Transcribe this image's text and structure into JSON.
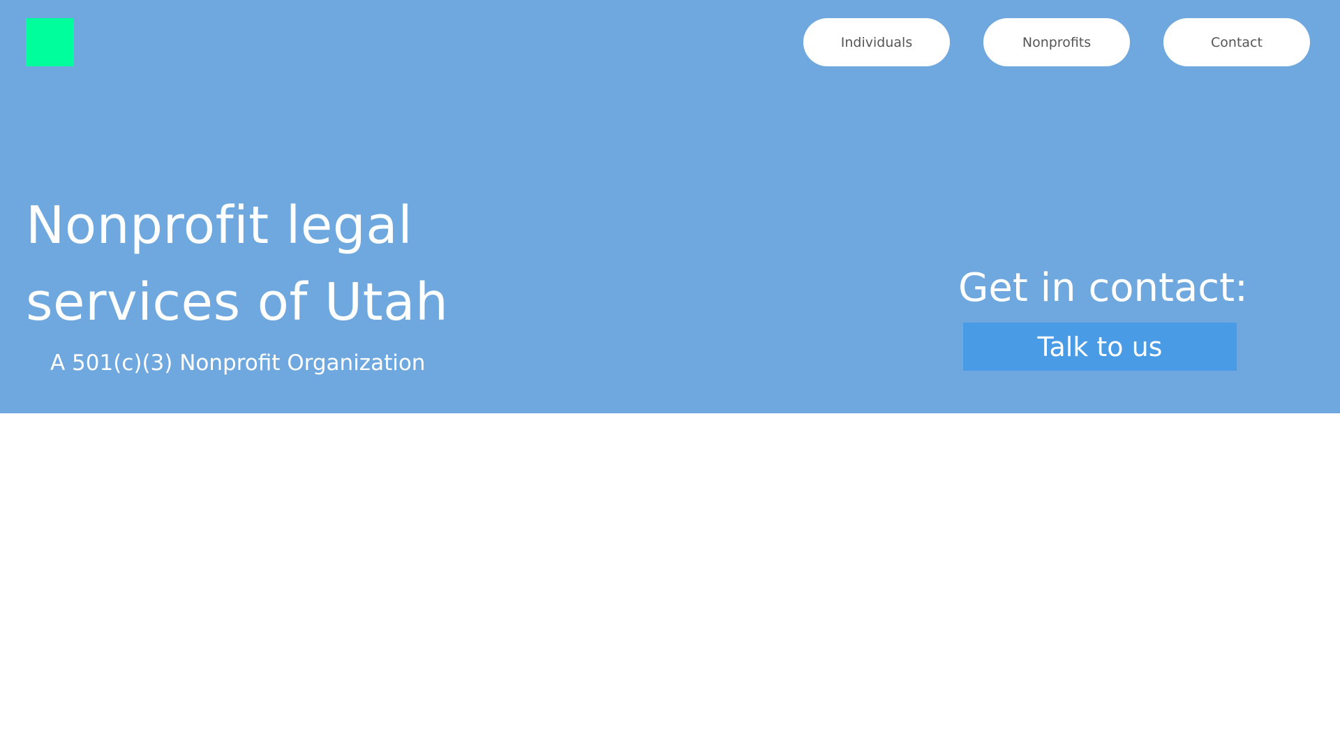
{
  "header": {
    "nav": [
      {
        "label": "Individuals"
      },
      {
        "label": "Nonprofits"
      },
      {
        "label": "Contact"
      }
    ]
  },
  "hero": {
    "title_line1": "Nonprofit legal",
    "title_line2": "services of Utah",
    "subtitle": "A 501(c)(3) Nonprofit Organization"
  },
  "contact": {
    "heading": "Get in contact:",
    "button_label": "Talk to us"
  },
  "colors": {
    "hero_background": "#6fa8df",
    "logo": "#00ff9c",
    "cta_button": "#4a9be5"
  }
}
